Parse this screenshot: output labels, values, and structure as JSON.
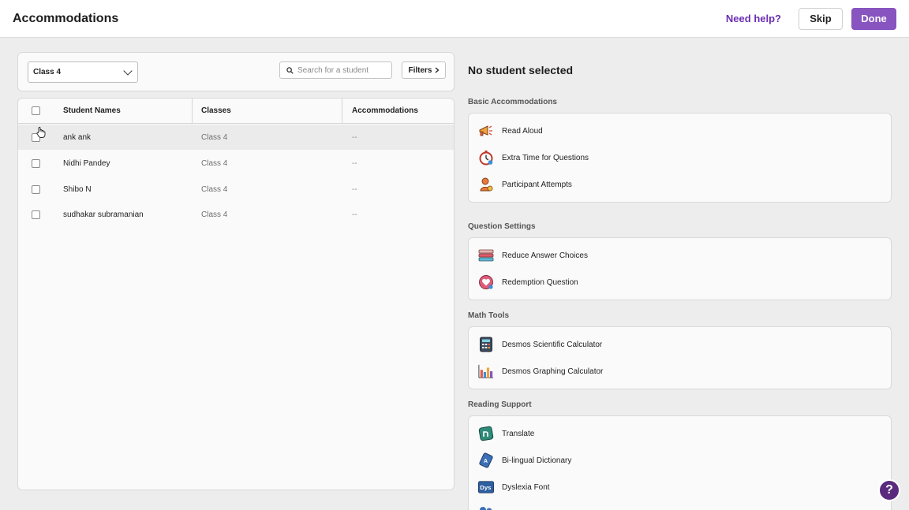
{
  "header": {
    "title": "Accommodations",
    "help_label": "Need help?",
    "skip_label": "Skip",
    "done_label": "Done"
  },
  "filters": {
    "class_selected": "Class 4",
    "search_placeholder": "Search for a student",
    "filters_label": "Filters"
  },
  "table": {
    "columns": [
      "Student Names",
      "Classes",
      "Accommodations"
    ],
    "rows": [
      {
        "name": "ank ank",
        "class": "Class 4",
        "accommodations": "--"
      },
      {
        "name": "Nidhi Pandey",
        "class": "Class 4",
        "accommodations": "--"
      },
      {
        "name": "Shibo N",
        "class": "Class 4",
        "accommodations": "--"
      },
      {
        "name": "sudhakar subramanian",
        "class": "Class 4",
        "accommodations": "--"
      }
    ]
  },
  "panel": {
    "title": "No student selected",
    "sections": [
      {
        "label": "Basic Accommodations",
        "items": [
          "Read Aloud",
          "Extra Time for Questions",
          "Participant Attempts"
        ]
      },
      {
        "label": "Question Settings",
        "items": [
          "Reduce Answer Choices",
          "Redemption Question"
        ]
      },
      {
        "label": "Math Tools",
        "items": [
          "Desmos Scientific Calculator",
          "Desmos Graphing Calculator"
        ]
      },
      {
        "label": "Reading Support",
        "items": [
          "Translate",
          "Bi-lingual Dictionary",
          "Dyslexia Font"
        ]
      }
    ]
  },
  "help_fab": "?",
  "colors": {
    "accent": "#8854c0",
    "link": "#6b2fb3",
    "fab": "#5a2a7e"
  }
}
